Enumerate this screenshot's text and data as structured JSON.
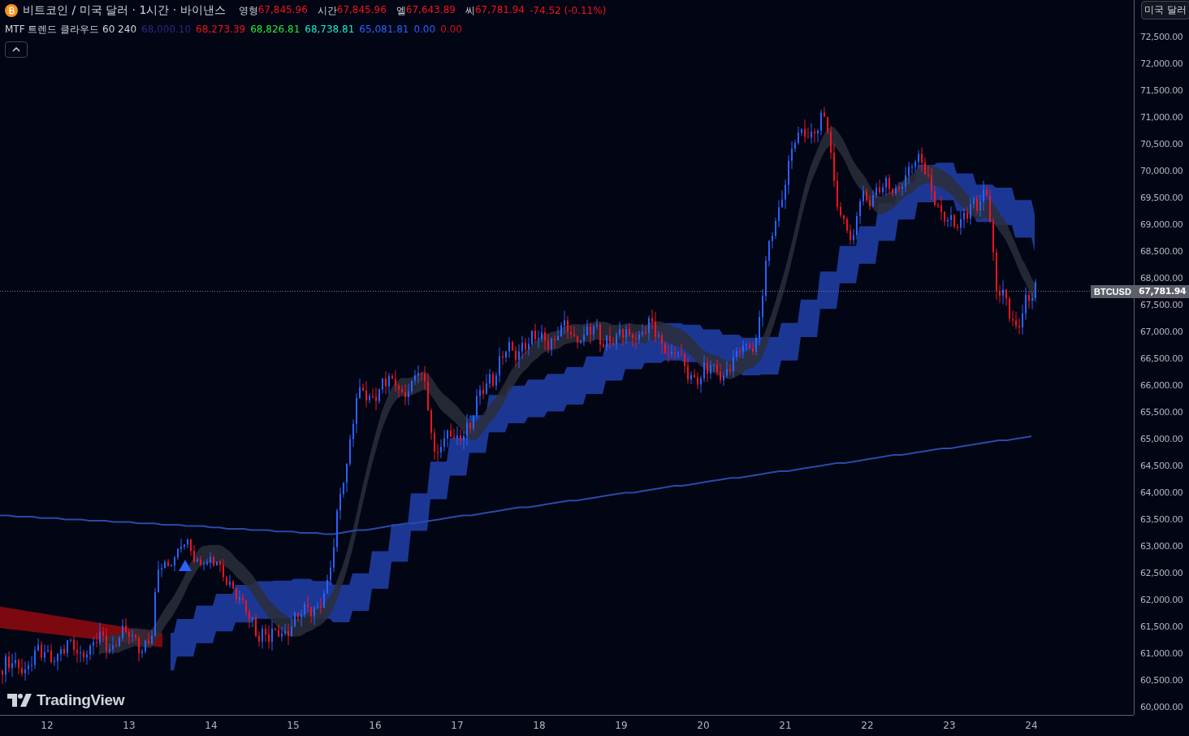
{
  "legend": {
    "symbol": "비트코인 / 미국 달러 · 1시간 · 바이낸스",
    "ohlc": [
      {
        "label": "영형",
        "value": "67,845.96"
      },
      {
        "label": "시간",
        "value": "67,845.96"
      },
      {
        "label": "엘",
        "value": "67,643.89"
      },
      {
        "label": "씨",
        "value": "67,781.94"
      }
    ],
    "change": "-74.52 (-0.11%)"
  },
  "indicator": {
    "name": "MTF 트렌드 클라우드 60 240",
    "values": [
      {
        "text": "68,000.10",
        "color": "#2c2783"
      },
      {
        "text": "68,273.39",
        "color": "#f0141e"
      },
      {
        "text": "68,826.81",
        "color": "#2fe33a"
      },
      {
        "text": "68,738.81",
        "color": "#1de9c6"
      },
      {
        "text": "65,081.81",
        "color": "#2962ff"
      },
      {
        "text": "0.00",
        "color": "#2962ff"
      },
      {
        "text": "0.00",
        "color": "#d0101a"
      }
    ]
  },
  "currency_button": "미국 달러",
  "price_axis": [
    "72,500.00",
    "72,000.00",
    "71,500.00",
    "71,000.00",
    "70,500.00",
    "70,000.00",
    "69,500.00",
    "69,000.00",
    "68,500.00",
    "68,000.00",
    "67,500.00",
    "67,000.00",
    "66,500.00",
    "66,000.00",
    "65,500.00",
    "65,000.00",
    "64,500.00",
    "64,000.00",
    "63,500.00",
    "63,000.00",
    "62,500.00",
    "62,000.00",
    "61,500.00",
    "61,000.00",
    "60,500.00",
    "60,000.00"
  ],
  "last_price": {
    "symbol": "BTCUSD",
    "price": "67,781.94"
  },
  "time_axis": [
    "12",
    "13",
    "14",
    "15",
    "16",
    "17",
    "18",
    "19",
    "20",
    "21",
    "22",
    "23",
    "24"
  ],
  "logo": "TradingView"
}
